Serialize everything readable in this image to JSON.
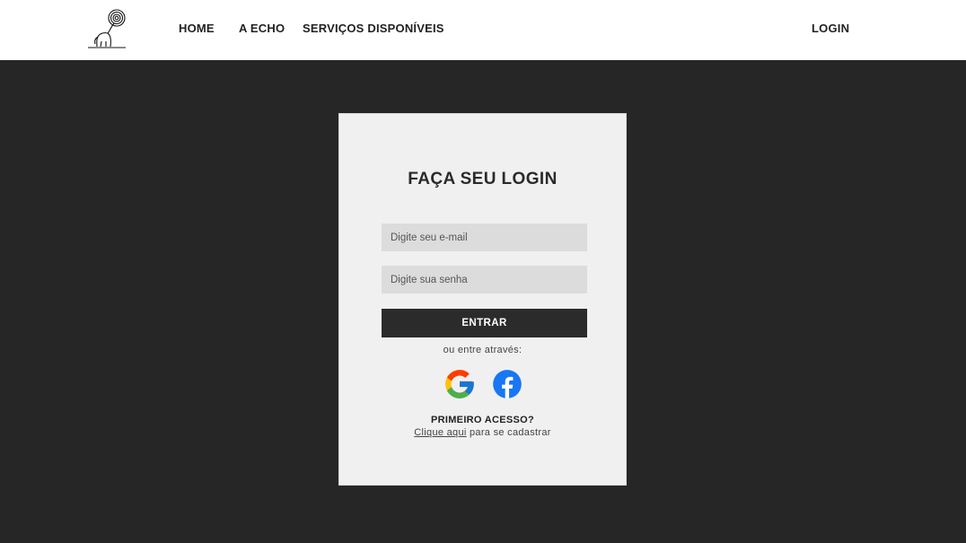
{
  "navbar": {
    "logo_icon": "elephant-spiral-logo-icon",
    "links": {
      "home": "HOME",
      "about": "A ECHO",
      "services": "SERVIÇOS DISPONÍVEIS",
      "login": "LOGIN"
    }
  },
  "login_card": {
    "title": "FAÇA SEU LOGIN",
    "email": {
      "placeholder": "Digite seu e-mail",
      "value": ""
    },
    "password": {
      "placeholder": "Digite sua senha",
      "value": ""
    },
    "submit_label": "ENTRAR",
    "alt_login_text": "ou entre através:",
    "social_icons": [
      "google-icon",
      "facebook-icon"
    ],
    "first_access": "PRIMEIRO ACESSO?",
    "signup_link": "Clique aqui",
    "signup_suffix": " para se cadastrar"
  },
  "colors": {
    "background": "#262626",
    "navbar": "#ffffff",
    "card": "#f0f0f0",
    "input": "#dcdcdc",
    "button": "#2b2b2b",
    "facebook": "#1877f2"
  }
}
